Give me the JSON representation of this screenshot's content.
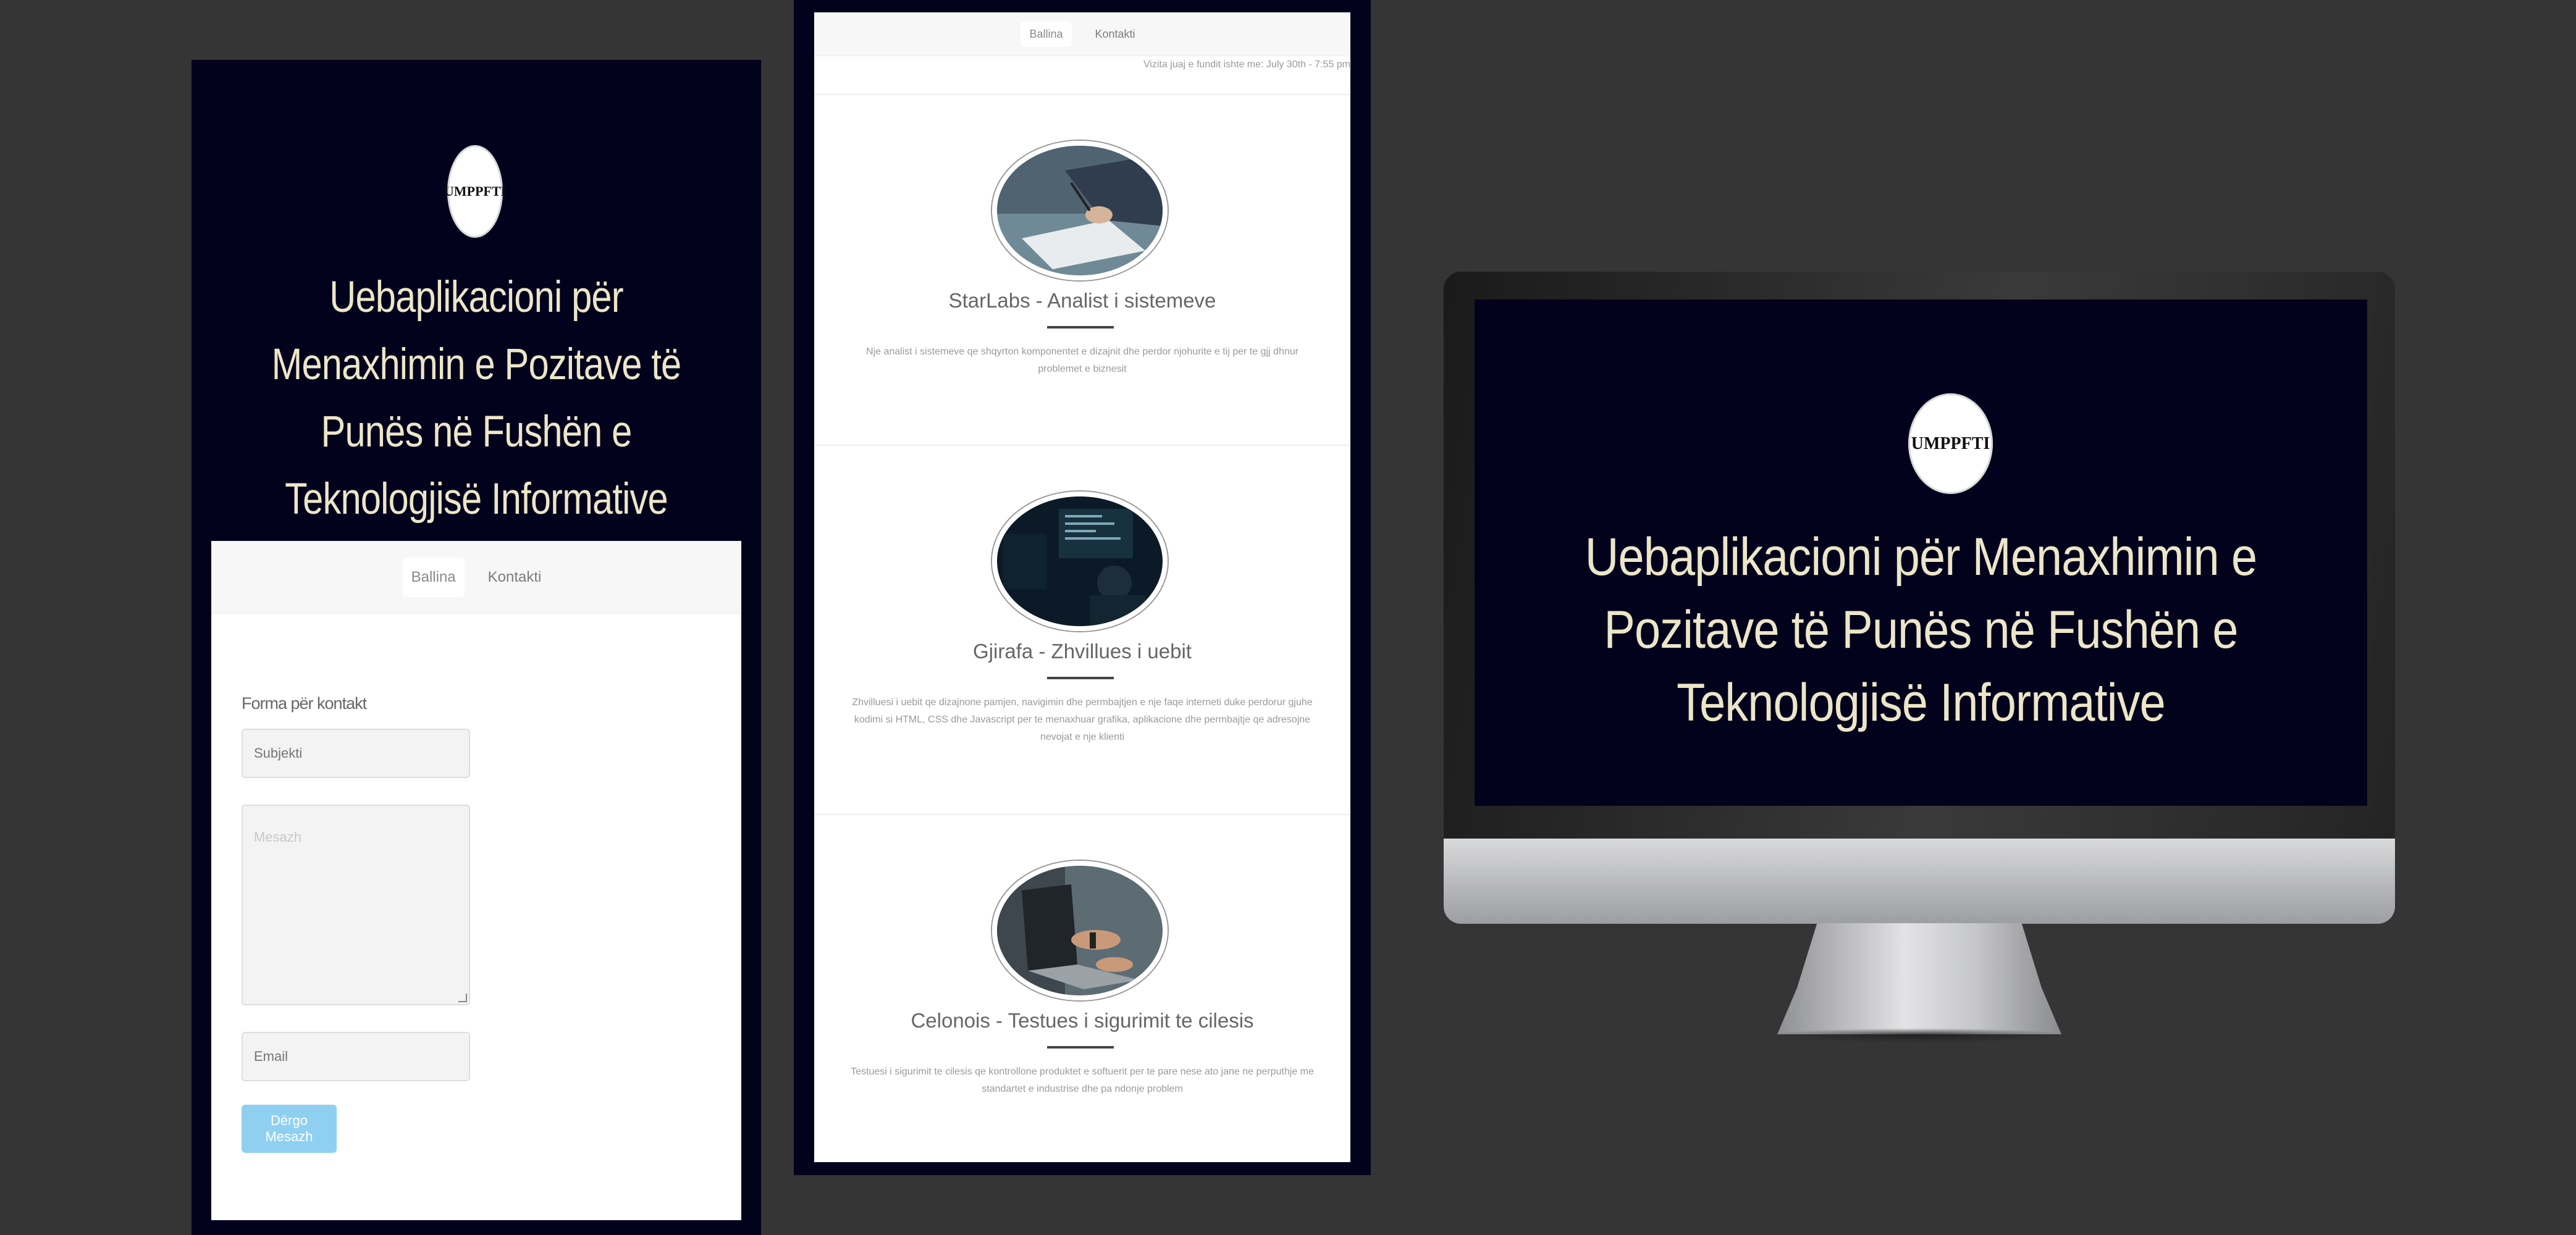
{
  "app": {
    "logo_text": "UMPPFTI",
    "hero_title": "Uebaplikacioni për Menaxhimin e Pozitave të Punës në Fushën e Teknologjisë Informative"
  },
  "nav": {
    "items": [
      {
        "label": "Ballina",
        "active": true
      },
      {
        "label": "Kontakti",
        "active": false
      }
    ]
  },
  "contact_form": {
    "title": "Forma për kontakt",
    "subject_placeholder": "Subjekti",
    "message_placeholder": "Mesazh",
    "email_placeholder": "Email",
    "submit_label": "Dërgo Mesazh"
  },
  "jobs_page": {
    "last_visit": "Vizita juaj e fundit ishte me: July 30th - 7:55 pm",
    "jobs": [
      {
        "title": "StarLabs - Analist i sistemeve",
        "description": "Nje analist i sistemeve qe shqyrton komponentet e dizajnit dhe perdor njohurite e tij per te gjj dhnur problemet e biznesit",
        "image": "person-writing-on-paper"
      },
      {
        "title": "Gjirafa - Zhvillues i uebit",
        "description": "Zhvilluesi i uebit qe dizajnone pamjen, navigimin dhe permbajtjen e nje faqe interneti duke perdorur gjuhe kodimi si HTML, CSS dhe Javascript per te menaxhuar grafika, aplikacione dhe permbajtje qe adresojne nevojat e nje klienti",
        "image": "developer-at-monitors"
      },
      {
        "title": "Celonois - Testues i sigurimit te cilesis",
        "description": "Testuesi i sigurimit te cilesis qe kontrollone produktet e softuerit per te pare nese ato jane ne perputhje me standartet e industrise dhe pa ndonje problem",
        "image": "hands-on-laptop"
      }
    ]
  },
  "colors": {
    "background": "#353535",
    "hero_navy": "#03021d",
    "hero_text": "#ece6c8",
    "submit_button": "#8fd0f1"
  }
}
